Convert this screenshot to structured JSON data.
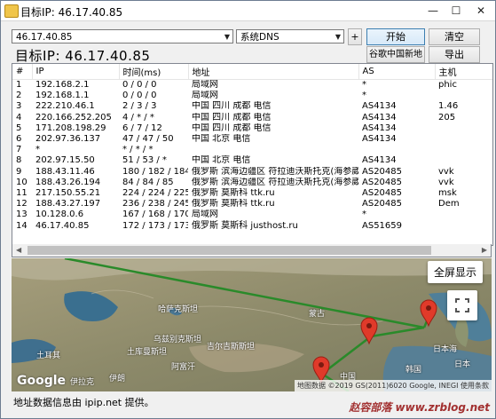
{
  "window": {
    "title": "目标IP: 46.17.40.85",
    "minimize": "—",
    "maximize": "☐",
    "close": "✕"
  },
  "controls": {
    "ip_input_value": "46.17.40.85",
    "dns_select_value": "系统DNS",
    "plus_label": "+",
    "start_label": "开始",
    "clear_label": "清空",
    "google_map_label": "谷歌中国新地图",
    "export_label": "导出"
  },
  "target_label": "目标IP:  46.17.40.85",
  "table": {
    "columns": [
      "#",
      "IP",
      "时间(ms)",
      "地址",
      "AS",
      "主机"
    ],
    "rows": [
      [
        "1",
        "192.168.2.1",
        "0 / 0 / 0",
        "局域网",
        "*",
        "phic"
      ],
      [
        "2",
        "192.168.1.1",
        "0 / 0 / 0",
        "局域网",
        "*",
        ""
      ],
      [
        "3",
        "222.210.46.1",
        "2 / 3 / 3",
        "中国 四川 成都 电信",
        "AS4134",
        "1.46"
      ],
      [
        "4",
        "220.166.252.205",
        "4 / * / *",
        "中国 四川 成都 电信",
        "AS4134",
        "205"
      ],
      [
        "5",
        "171.208.198.29",
        "6 / 7 / 12",
        "中国 四川 成都 电信",
        "AS4134",
        ""
      ],
      [
        "6",
        "202.97.36.137",
        "47 / 47 / 50",
        "中国 北京 电信",
        "AS4134",
        ""
      ],
      [
        "7",
        "*",
        "* / * / *",
        "",
        "",
        ""
      ],
      [
        "8",
        "202.97.15.50",
        "51 / 53 / *",
        "中国 北京 电信",
        "AS4134",
        ""
      ],
      [
        "9",
        "188.43.11.46",
        "180 / 182 / 184",
        "俄罗斯 滨海边疆区 符拉迪沃斯托克(海参崴...",
        "AS20485",
        "vvk"
      ],
      [
        "10",
        "188.43.26.194",
        "84 / 84 / 85",
        "俄罗斯 滨海边疆区 符拉迪沃斯托克(海参崴...",
        "AS20485",
        "vvk"
      ],
      [
        "11",
        "217.150.55.21",
        "224 / 224 / 225",
        "俄罗斯 莫斯科 ttk.ru",
        "AS20485",
        "msk"
      ],
      [
        "12",
        "188.43.27.197",
        "236 / 238 / 245",
        "俄罗斯 莫斯科 ttk.ru",
        "AS20485",
        "Dem"
      ],
      [
        "13",
        "10.128.0.6",
        "167 / 168 / 170",
        "局域网",
        "*",
        ""
      ],
      [
        "14",
        "46.17.40.85",
        "172 / 173 / 173",
        "俄罗斯 莫斯科 justhost.ru",
        "AS51659",
        ""
      ]
    ]
  },
  "map": {
    "fullscreen_label": "全屏显示",
    "labels": {
      "kazakhstan": "哈萨克斯坦",
      "mongolia": "蒙古",
      "turkey": "土耳其",
      "afghanistan": "阿富汗",
      "iran": "伊朗",
      "turkmenistan": "土库曼斯坦",
      "uzbekistan": "乌兹别克斯坦",
      "kyrgyzstan": "吉尔吉斯斯坦",
      "iraq": "伊拉克",
      "japan": "日本",
      "korea": "韩国",
      "china": "中国",
      "japan_sea": "日本海"
    },
    "google_logo": "Google",
    "attribution": "地图数据 ©2019 GS(2011)6020 Google, INEGI   使用条款",
    "route_color": "#2a8a2a",
    "marker_color": "#e03a2a"
  },
  "footer": {
    "text": "地址数据信息由 ipip.net 提供。",
    "watermark": "赵容部落 www.zrblog.net"
  }
}
